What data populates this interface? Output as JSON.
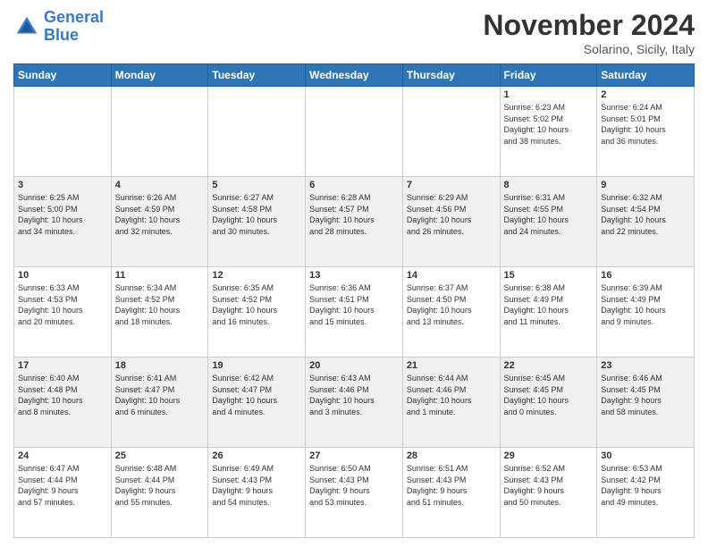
{
  "logo": {
    "line1": "General",
    "line2": "Blue"
  },
  "header": {
    "title": "November 2024",
    "subtitle": "Solarino, Sicily, Italy"
  },
  "days_of_week": [
    "Sunday",
    "Monday",
    "Tuesday",
    "Wednesday",
    "Thursday",
    "Friday",
    "Saturday"
  ],
  "weeks": [
    [
      {
        "day": "",
        "info": ""
      },
      {
        "day": "",
        "info": ""
      },
      {
        "day": "",
        "info": ""
      },
      {
        "day": "",
        "info": ""
      },
      {
        "day": "",
        "info": ""
      },
      {
        "day": "1",
        "info": "Sunrise: 6:23 AM\nSunset: 5:02 PM\nDaylight: 10 hours\nand 38 minutes."
      },
      {
        "day": "2",
        "info": "Sunrise: 6:24 AM\nSunset: 5:01 PM\nDaylight: 10 hours\nand 36 minutes."
      }
    ],
    [
      {
        "day": "3",
        "info": "Sunrise: 6:25 AM\nSunset: 5:00 PM\nDaylight: 10 hours\nand 34 minutes."
      },
      {
        "day": "4",
        "info": "Sunrise: 6:26 AM\nSunset: 4:59 PM\nDaylight: 10 hours\nand 32 minutes."
      },
      {
        "day": "5",
        "info": "Sunrise: 6:27 AM\nSunset: 4:58 PM\nDaylight: 10 hours\nand 30 minutes."
      },
      {
        "day": "6",
        "info": "Sunrise: 6:28 AM\nSunset: 4:57 PM\nDaylight: 10 hours\nand 28 minutes."
      },
      {
        "day": "7",
        "info": "Sunrise: 6:29 AM\nSunset: 4:56 PM\nDaylight: 10 hours\nand 26 minutes."
      },
      {
        "day": "8",
        "info": "Sunrise: 6:31 AM\nSunset: 4:55 PM\nDaylight: 10 hours\nand 24 minutes."
      },
      {
        "day": "9",
        "info": "Sunrise: 6:32 AM\nSunset: 4:54 PM\nDaylight: 10 hours\nand 22 minutes."
      }
    ],
    [
      {
        "day": "10",
        "info": "Sunrise: 6:33 AM\nSunset: 4:53 PM\nDaylight: 10 hours\nand 20 minutes."
      },
      {
        "day": "11",
        "info": "Sunrise: 6:34 AM\nSunset: 4:52 PM\nDaylight: 10 hours\nand 18 minutes."
      },
      {
        "day": "12",
        "info": "Sunrise: 6:35 AM\nSunset: 4:52 PM\nDaylight: 10 hours\nand 16 minutes."
      },
      {
        "day": "13",
        "info": "Sunrise: 6:36 AM\nSunset: 4:51 PM\nDaylight: 10 hours\nand 15 minutes."
      },
      {
        "day": "14",
        "info": "Sunrise: 6:37 AM\nSunset: 4:50 PM\nDaylight: 10 hours\nand 13 minutes."
      },
      {
        "day": "15",
        "info": "Sunrise: 6:38 AM\nSunset: 4:49 PM\nDaylight: 10 hours\nand 11 minutes."
      },
      {
        "day": "16",
        "info": "Sunrise: 6:39 AM\nSunset: 4:49 PM\nDaylight: 10 hours\nand 9 minutes."
      }
    ],
    [
      {
        "day": "17",
        "info": "Sunrise: 6:40 AM\nSunset: 4:48 PM\nDaylight: 10 hours\nand 8 minutes."
      },
      {
        "day": "18",
        "info": "Sunrise: 6:41 AM\nSunset: 4:47 PM\nDaylight: 10 hours\nand 6 minutes."
      },
      {
        "day": "19",
        "info": "Sunrise: 6:42 AM\nSunset: 4:47 PM\nDaylight: 10 hours\nand 4 minutes."
      },
      {
        "day": "20",
        "info": "Sunrise: 6:43 AM\nSunset: 4:46 PM\nDaylight: 10 hours\nand 3 minutes."
      },
      {
        "day": "21",
        "info": "Sunrise: 6:44 AM\nSunset: 4:46 PM\nDaylight: 10 hours\nand 1 minute."
      },
      {
        "day": "22",
        "info": "Sunrise: 6:45 AM\nSunset: 4:45 PM\nDaylight: 10 hours\nand 0 minutes."
      },
      {
        "day": "23",
        "info": "Sunrise: 6:46 AM\nSunset: 4:45 PM\nDaylight: 9 hours\nand 58 minutes."
      }
    ],
    [
      {
        "day": "24",
        "info": "Sunrise: 6:47 AM\nSunset: 4:44 PM\nDaylight: 9 hours\nand 57 minutes."
      },
      {
        "day": "25",
        "info": "Sunrise: 6:48 AM\nSunset: 4:44 PM\nDaylight: 9 hours\nand 55 minutes."
      },
      {
        "day": "26",
        "info": "Sunrise: 6:49 AM\nSunset: 4:43 PM\nDaylight: 9 hours\nand 54 minutes."
      },
      {
        "day": "27",
        "info": "Sunrise: 6:50 AM\nSunset: 4:43 PM\nDaylight: 9 hours\nand 53 minutes."
      },
      {
        "day": "28",
        "info": "Sunrise: 6:51 AM\nSunset: 4:43 PM\nDaylight: 9 hours\nand 51 minutes."
      },
      {
        "day": "29",
        "info": "Sunrise: 6:52 AM\nSunset: 4:43 PM\nDaylight: 9 hours\nand 50 minutes."
      },
      {
        "day": "30",
        "info": "Sunrise: 6:53 AM\nSunset: 4:42 PM\nDaylight: 9 hours\nand 49 minutes."
      }
    ]
  ]
}
